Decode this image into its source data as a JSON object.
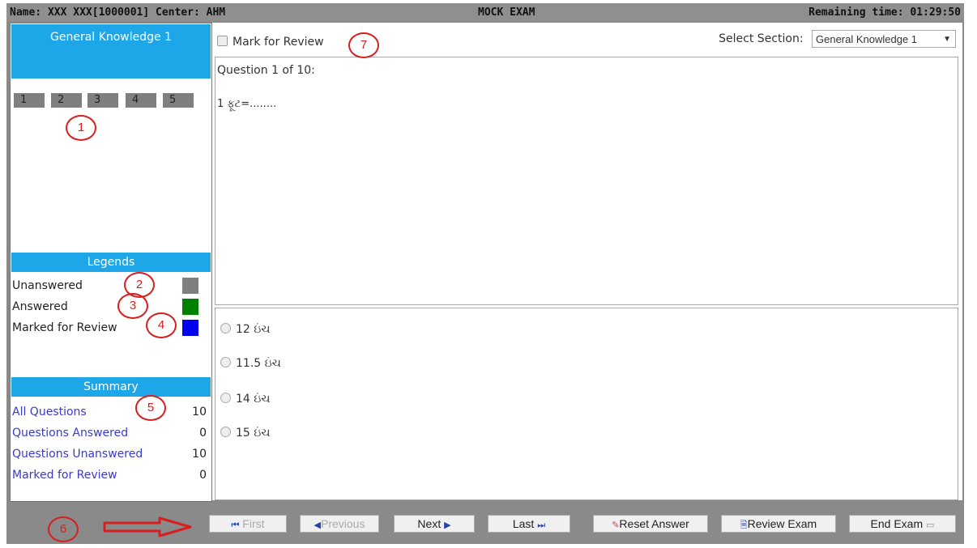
{
  "header": {
    "left": "Name: XXX XXX[1000001] Center: AHM",
    "center": "MOCK EXAM",
    "right": "Remaining time: 01:29:50"
  },
  "left_panel": {
    "section_title": "General Knowledge 1",
    "question_numbers": [
      "1",
      "2",
      "3",
      "4",
      "5"
    ],
    "legends_title": "Legends",
    "legends": [
      {
        "label": "Unanswered",
        "color": "#7f7f7f"
      },
      {
        "label": "Answered",
        "color": "#008000"
      },
      {
        "label": "Marked for Review",
        "color": "#0000ee"
      }
    ],
    "summary_title": "Summary",
    "summary": [
      {
        "label": "All Questions",
        "value": "10"
      },
      {
        "label": "Questions Answered",
        "value": "0"
      },
      {
        "label": "Questions Unanswered",
        "value": "10"
      },
      {
        "label": "Marked for Review",
        "value": "0"
      }
    ]
  },
  "main": {
    "mark_for_review_label": "Mark for Review",
    "select_section_label": "Select Section:",
    "selected_section": "General Knowledge 1",
    "question_header": "Question 1 of 10:",
    "question_text": "1 ફૂટ=........",
    "options": [
      "12 ઇંચ",
      "11.5 ઇંચ",
      "14 ઇંચ",
      "15 ઇંચ"
    ]
  },
  "footer": {
    "buttons": [
      "First",
      "Previous",
      "Next",
      "Last",
      "Reset Answer",
      "Review Exam",
      "End Exam"
    ]
  },
  "annotations": [
    "1",
    "2",
    "3",
    "4",
    "5",
    "6",
    "7"
  ],
  "colors": {
    "blue_bar": "#1ea7e8",
    "frame_gray": "#8a8a8a",
    "annotation_red": "#d81e1e"
  }
}
